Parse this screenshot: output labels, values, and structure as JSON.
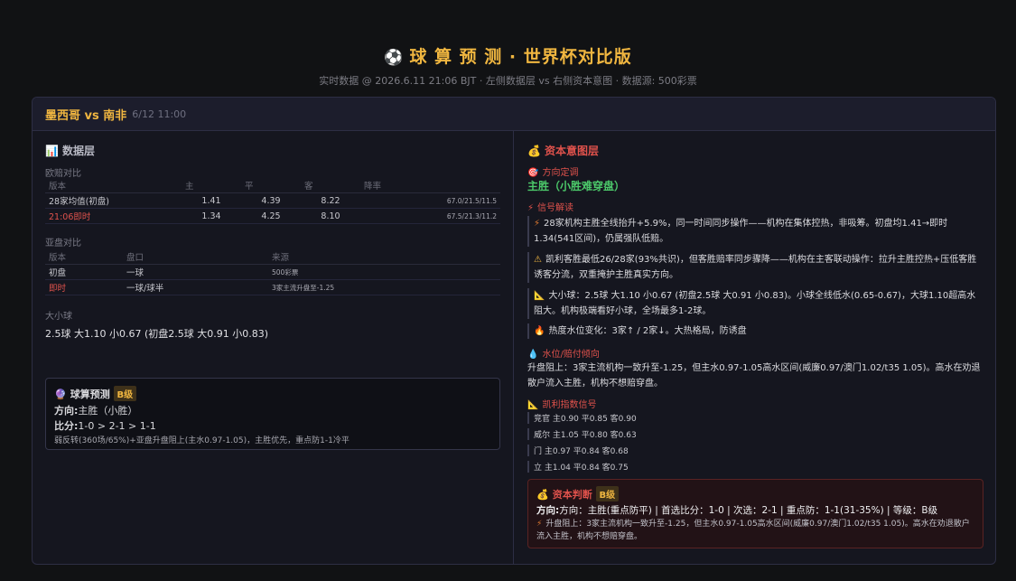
{
  "header": {
    "icon": "soccer-ball-icon",
    "title": "球 算 预 测 · 世界杯对比版",
    "subtitle": "实时数据 @ 2026.6.11 21:06 BJT · 左侧数据层 vs 右侧资本意图 · 数据源: 500彩票"
  },
  "match": {
    "title": "墨西哥 vs 南非",
    "date": "6/12 11:00"
  },
  "left": {
    "section_title": "数据层",
    "euro_label": "欧赔对比",
    "euro_headers": [
      "版本",
      "主",
      "平",
      "客",
      "降率"
    ],
    "euro_rows": [
      {
        "name": "28家均值(初盘)",
        "home": "1.41",
        "draw": "4.39",
        "away": "8.22",
        "rate": "67.0/21.5/11.5"
      },
      {
        "name": "21:06即时",
        "home": "1.34",
        "draw": "4.25",
        "away": "8.10",
        "rate": "67.5/21.3/11.2"
      }
    ],
    "asia_label": "亚盘对比",
    "asia_headers": [
      "版本",
      "盘口",
      "来源"
    ],
    "asia_rows": [
      {
        "name": "初盘",
        "line": "一球",
        "src": "500彩票"
      },
      {
        "name": "即时",
        "line": "一球/球半",
        "src": "3家主流升盘至-1.25"
      }
    ],
    "ou_label": "大小球",
    "ou_text": "2.5球 大1.10 小0.67 (初盘2.5球 大0.91 小0.83)",
    "pred": {
      "title": "球算预测",
      "grade": "B级",
      "direction_label": "方向:",
      "direction": "主胜（小胜）",
      "score_label": "比分:",
      "score": "1-0 > 2-1 > 1-1",
      "note": "弱反转(360场/65%)+亚盘升盘阻上(主水0.97-1.05)，主胜优先，重点防1-1冷平"
    }
  },
  "right": {
    "section_title": "资本意图层",
    "dir_label": "方向定调",
    "dir_value": "主胜（小胜难穿盘）",
    "signal_label": "信号解读",
    "signals": [
      "28家机构主胜全线抬升+5.9%，同一时间同步操作——机构在集体控热，非吸筹。初盘均1.41→即时1.34(541区间)，仍属强队低赔。",
      "凯利客胜最低26/28家(93%共识)，但客胜赔率同步骤降——机构在主客联动操作：拉升主胜控热+压低客胜诱客分流，双重掩护主胜真实方向。",
      "大小球：2.5球 大1.10 小0.67 (初盘2.5球 大0.91 小0.83)。小球全线低水(0.65-0.67)，大球1.10超高水阻大。机构极端看好小球，全场最多1-2球。",
      "热度水位变化：3家↑ / 2家↓。大热格局，防诱盘"
    ],
    "water_label": "水位/赔付倾向",
    "water_text": "升盘阻上：3家主流机构一致升至-1.25，但主水0.97-1.05高水区间(威廉0.97/澳门1.02/t35 1.05)。高水在劝退散户流入主胜，机构不想赔穿盘。",
    "kelly_label": "凯利指数信号",
    "kelly_rows": [
      "竞官 主0.90 平0.85 客0.90",
      "威尔 主1.05 平0.80 客0.63",
      "门 主0.97 平0.84 客0.68",
      "立 主1.04 平0.84 客0.75"
    ],
    "judge": {
      "title": "资本判断",
      "grade": "B级",
      "direction_label": "方向:",
      "direction": "方向：主胜(重点防平) | 首选比分：1-0 | 次选：2-1 | 重点防：1-1(31-35%) | 等级：B级",
      "note": "升盘阻上：3家主流机构一致升至-1.25，但主水0.97-1.05高水区间(威廉0.97/澳门1.02/t35 1.05)。高水在劝退散户流入主胜，机构不想赔穿盘。"
    }
  },
  "colors": {
    "accent": "#f0b640",
    "red": "#e0524c",
    "green": "#4cc96a",
    "bg": "#111214"
  }
}
